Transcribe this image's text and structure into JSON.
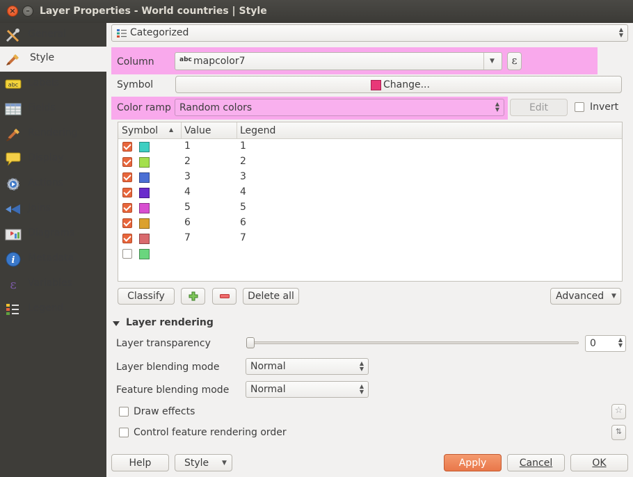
{
  "window": {
    "title": "Layer Properties - World countries | Style"
  },
  "sidebar": {
    "items": [
      {
        "label": "General",
        "icon": "general-tools-icon",
        "active": false
      },
      {
        "label": "Style",
        "icon": "style-brush-icon",
        "active": true
      },
      {
        "label": "Labels",
        "icon": "labels-abc-icon",
        "active": false
      },
      {
        "label": "Fields",
        "icon": "fields-table-icon",
        "active": false
      },
      {
        "label": "Rendering",
        "icon": "rendering-brush-icon",
        "active": false
      },
      {
        "label": "Display",
        "icon": "display-speech-icon",
        "active": false
      },
      {
        "label": "Actions",
        "icon": "actions-gear-icon",
        "active": false
      },
      {
        "label": "Joins",
        "icon": "joins-icon",
        "active": false
      },
      {
        "label": "Diagrams",
        "icon": "diagrams-icon",
        "active": false
      },
      {
        "label": "Metadata",
        "icon": "metadata-info-icon",
        "active": false
      },
      {
        "label": "Variables",
        "icon": "variables-epsilon-icon",
        "active": false
      },
      {
        "label": "Legend",
        "icon": "legend-icon",
        "active": false
      }
    ]
  },
  "renderer": {
    "selected": "Categorized"
  },
  "column": {
    "label": "Column",
    "type_tag": "abc",
    "value": "mapcolor7",
    "expression_symbol": "ε"
  },
  "symbol": {
    "label": "Symbol",
    "button_label": "Change...",
    "color": "#e83878"
  },
  "color_ramp": {
    "label": "Color ramp",
    "value": "Random colors",
    "edit_label": "Edit",
    "invert_label": "Invert"
  },
  "table": {
    "headers": [
      "Symbol",
      "Value",
      "Legend"
    ],
    "rows": [
      {
        "checked": true,
        "color": "#3dcfc2",
        "value": "1",
        "legend": "1"
      },
      {
        "checked": true,
        "color": "#a4e04c",
        "value": "2",
        "legend": "2"
      },
      {
        "checked": true,
        "color": "#4a6fd4",
        "value": "3",
        "legend": "3"
      },
      {
        "checked": true,
        "color": "#6a2ccc",
        "value": "4",
        "legend": "4"
      },
      {
        "checked": true,
        "color": "#d84fd0",
        "value": "5",
        "legend": "5"
      },
      {
        "checked": true,
        "color": "#dba12d",
        "value": "6",
        "legend": "6"
      },
      {
        "checked": true,
        "color": "#d96a6e",
        "value": "7",
        "legend": "7"
      },
      {
        "checked": false,
        "color": "#6ad67e",
        "value": "",
        "legend": ""
      }
    ]
  },
  "actions": {
    "classify": "Classify",
    "delete_all": "Delete all",
    "advanced": "Advanced"
  },
  "layer_rendering": {
    "title": "Layer rendering",
    "transparency_label": "Layer transparency",
    "transparency_value": "0",
    "layer_blending_label": "Layer blending mode",
    "layer_blending_value": "Normal",
    "feature_blending_label": "Feature blending mode",
    "feature_blending_value": "Normal",
    "draw_effects_label": "Draw effects",
    "order_label": "Control feature rendering order"
  },
  "footer": {
    "help": "Help",
    "style": "Style",
    "apply": "Apply",
    "cancel": "Cancel",
    "ok": "OK"
  },
  "colors": {
    "highlight": "#f9a9ec",
    "apply_button": "#f08a5d",
    "accent": "#e8663c"
  }
}
